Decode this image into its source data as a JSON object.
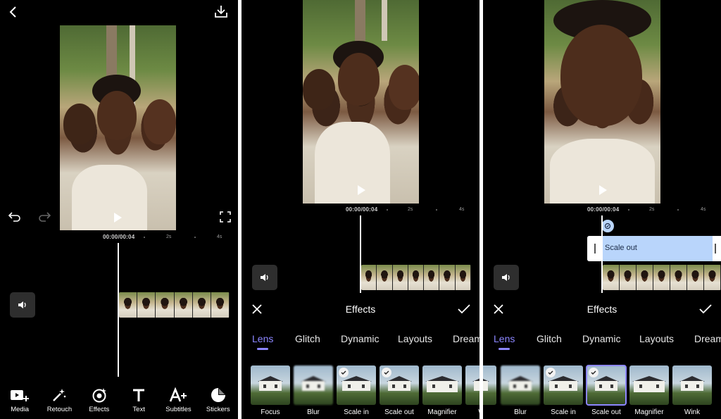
{
  "colors": {
    "accent": "#8c86ff",
    "background": "#000000",
    "effect_bar": "#b9d5fb"
  },
  "screen1": {
    "icons": {
      "back": "chevron-left-icon",
      "download": "download-icon",
      "undo": "undo-icon",
      "redo": "redo-icon",
      "fullscreen": "fullscreen-icon"
    },
    "timecode": "00:00/00:04",
    "ticks": [
      "2s",
      "4s"
    ],
    "toolbar": [
      {
        "label": "Media",
        "icon": "media-add-icon"
      },
      {
        "label": "Retouch",
        "icon": "magic-wand-icon"
      },
      {
        "label": "Effects",
        "icon": "effects-icon"
      },
      {
        "label": "Text",
        "icon": "text-icon"
      },
      {
        "label": "Subtitles",
        "icon": "subtitles-icon"
      },
      {
        "label": "Stickers",
        "icon": "sticker-icon"
      }
    ]
  },
  "screen2": {
    "timecode": "00:00/00:04",
    "ticks": [
      "2s",
      "4s"
    ],
    "sheet": {
      "title": "Effects",
      "tabs": [
        "Lens",
        "Glitch",
        "Dynamic",
        "Layouts",
        "Dream"
      ],
      "active_tab": "Lens",
      "effects": [
        {
          "label": "Focus",
          "checked": false
        },
        {
          "label": "Blur",
          "checked": false
        },
        {
          "label": "Scale in",
          "checked": true
        },
        {
          "label": "Scale out",
          "checked": true
        },
        {
          "label": "Magnifier",
          "checked": false
        },
        {
          "label": "W",
          "checked": false
        }
      ]
    }
  },
  "screen3": {
    "timecode": "00:00/00:04",
    "ticks": [
      "2s",
      "4s"
    ],
    "effect_track_label": "Scale out",
    "sheet": {
      "title": "Effects",
      "tabs": [
        "Lens",
        "Glitch",
        "Dynamic",
        "Layouts",
        "Dream"
      ],
      "active_tab": "Lens",
      "effects": [
        {
          "label": "",
          "checked": false
        },
        {
          "label": "Blur",
          "checked": false
        },
        {
          "label": "Scale in",
          "checked": true
        },
        {
          "label": "Scale out",
          "checked": true,
          "selected": true
        },
        {
          "label": "Magnifier",
          "checked": false
        },
        {
          "label": "Wink",
          "checked": false
        }
      ]
    }
  }
}
